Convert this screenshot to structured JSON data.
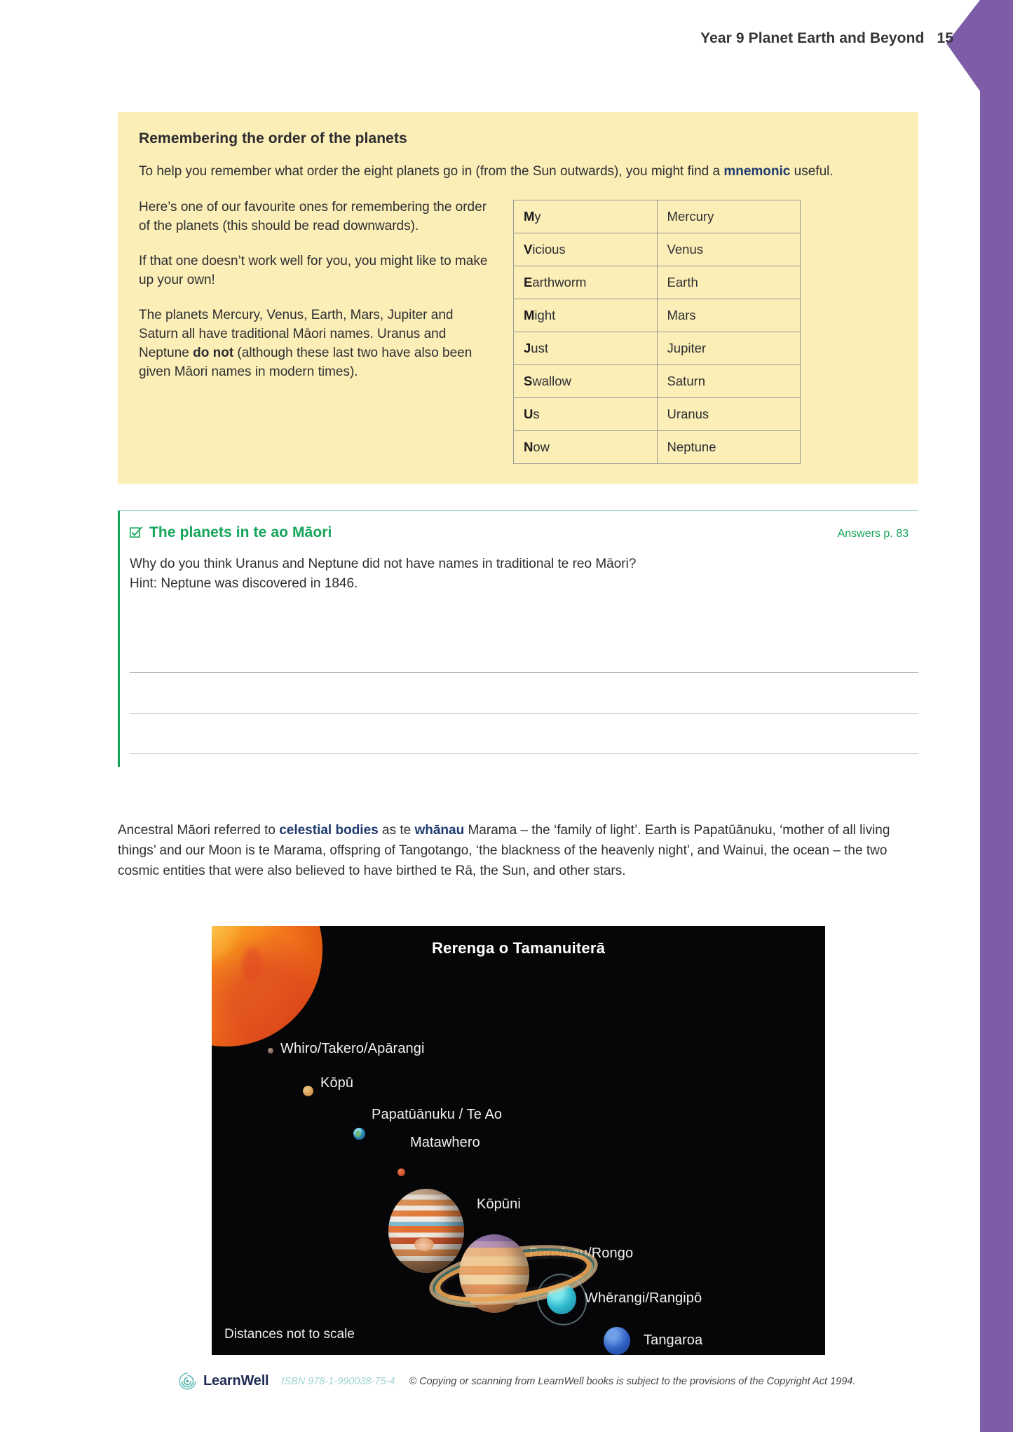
{
  "header": {
    "title": "Year 9 Planet Earth and Beyond",
    "page_number": "15"
  },
  "colors": {
    "purple_bar": "#7d5ca8",
    "yellow_box": "#fbeeb6",
    "activity_green": "#14a558",
    "term_blue": "#1f3a6e",
    "diagram_bg": "#060608"
  },
  "yellow_box": {
    "heading": "Remembering the order of the planets",
    "intro_before": "To help you remember what order the eight planets go in (from the Sun outwards), you might find a ",
    "intro_term": "mnemonic",
    "intro_after": " useful.",
    "para1": "Here’s one of our favourite ones for remembering the order of the planets (this should be read downwards).",
    "para2": "If that one doesn’t work well for you, you might like to make up your own!",
    "para3_before": "The planets Mercury, Venus, Earth, Mars, Jupiter and Saturn all have traditional Māori names. Uranus and Neptune ",
    "para3_bold": "do not",
    "para3_after": " (although these last two have also been given Māori names in modern times).",
    "table": {
      "rows": [
        {
          "mnemonic_cap": "M",
          "mnemonic_rest": "y",
          "planet": "Mercury"
        },
        {
          "mnemonic_cap": "V",
          "mnemonic_rest": "icious",
          "planet": "Venus"
        },
        {
          "mnemonic_cap": "E",
          "mnemonic_rest": "arthworm",
          "planet": "Earth"
        },
        {
          "mnemonic_cap": "M",
          "mnemonic_rest": "ight",
          "planet": "Mars"
        },
        {
          "mnemonic_cap": "J",
          "mnemonic_rest": "ust",
          "planet": "Jupiter"
        },
        {
          "mnemonic_cap": "S",
          "mnemonic_rest": "wallow",
          "planet": "Saturn"
        },
        {
          "mnemonic_cap": "U",
          "mnemonic_rest": "s",
          "planet": "Uranus"
        },
        {
          "mnemonic_cap": "N",
          "mnemonic_rest": "ow",
          "planet": "Neptune"
        }
      ]
    }
  },
  "activity": {
    "icon": "checkbox-tick-icon",
    "title": "The planets in te ao Māori",
    "answers_ref": "Answers p. 83",
    "question_line1": "Why do you think Uranus and Neptune did not have names in traditional te reo Māori?",
    "question_line2": "Hint: Neptune was discovered in 1846.",
    "answer_line_count": 3
  },
  "body_paragraph": {
    "seg1": "Ancestral Māori referred to ",
    "term1": "celestial bodies",
    "seg2": " as te ",
    "term2": "whānau",
    "seg3": " Marama – the ‘family of light’. Earth is Papatūānuku, ‘mother of all living things’ and our Moon is te Marama, offspring of Tangotango, ‘the blackness of the heavenly night’, and Wainui, the ocean – the two cosmic entities that were also believed to have birthed te Rā, the Sun, and other stars."
  },
  "diagram": {
    "title": "Rerenga o Tamanuiterā",
    "scale_note": "Distances not to scale",
    "sun_label": "",
    "planets": [
      {
        "name": "mercury",
        "label": "Whiro/Takero/Apārangi"
      },
      {
        "name": "venus",
        "label": "Kōpū"
      },
      {
        "name": "earth",
        "label": "Papatūānuku / Te Ao"
      },
      {
        "name": "mars",
        "label": "Matawhero"
      },
      {
        "name": "jupiter",
        "label": "Kōpūni"
      },
      {
        "name": "saturn",
        "label": "Pareārau/Rongo"
      },
      {
        "name": "uranus",
        "label": "Whērangi/Rangipō"
      },
      {
        "name": "neptune",
        "label": "Tangaroa"
      }
    ]
  },
  "footer": {
    "logo_icon": "koru-spiral-icon",
    "brand": "LearnWell",
    "isbn": "ISBN 978-1-990038-75-4",
    "copyright": "© Copying or scanning from LearnWell books is subject to the provisions of the Copyright Act 1994."
  }
}
